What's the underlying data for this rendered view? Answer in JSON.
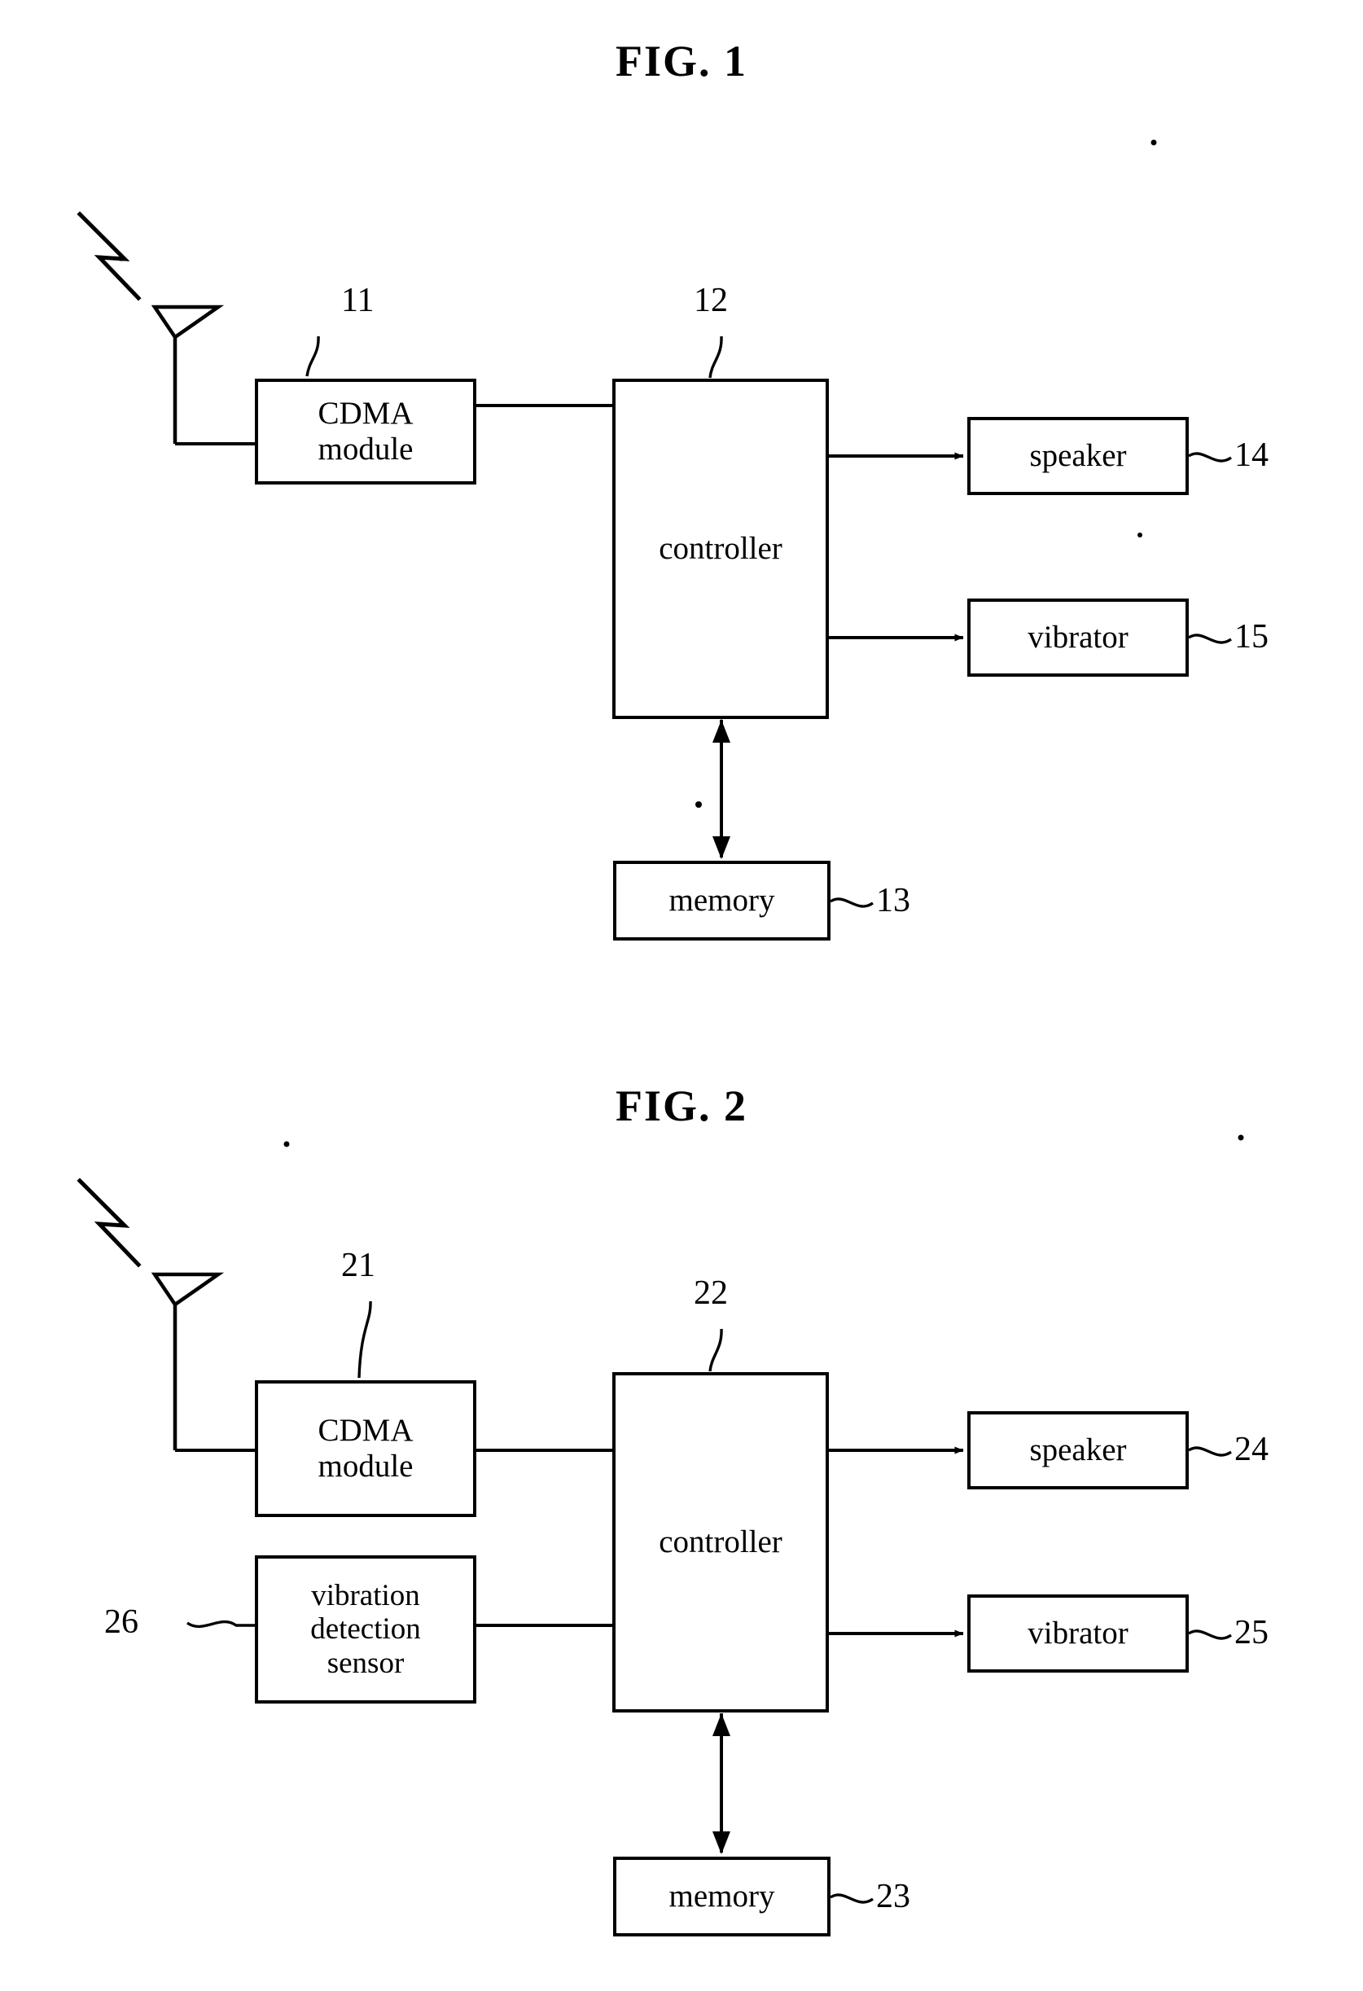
{
  "document": {
    "type": "patent-figure-sheet",
    "background_color": "#ffffff",
    "line_color": "#000000"
  },
  "figures": [
    {
      "title": "FIG. 1",
      "blocks": [
        {
          "id": "cdma-module-11",
          "label_line1": "CDMA",
          "label_line2": "module",
          "ref": "11"
        },
        {
          "id": "controller-12",
          "label_line1": "controller",
          "label_line2": "",
          "ref": "12"
        },
        {
          "id": "speaker-14",
          "label_line1": "speaker",
          "label_line2": "",
          "ref": "14"
        },
        {
          "id": "vibrator-15",
          "label_line1": "vibrator",
          "label_line2": "",
          "ref": "15"
        },
        {
          "id": "memory-13",
          "label_line1": "memory",
          "label_line2": "",
          "ref": "13"
        }
      ],
      "refs": [
        "11",
        "12",
        "13",
        "14",
        "15"
      ]
    },
    {
      "title": "FIG. 2",
      "blocks": [
        {
          "id": "cdma-module-21",
          "label_line1": "CDMA",
          "label_line2": "module",
          "ref": "21"
        },
        {
          "id": "controller-22",
          "label_line1": "controller",
          "label_line2": "",
          "ref": "22"
        },
        {
          "id": "speaker-24",
          "label_line1": "speaker",
          "label_line2": "",
          "ref": "24"
        },
        {
          "id": "vibrator-25",
          "label_line1": "vibrator",
          "label_line2": "",
          "ref": "25"
        },
        {
          "id": "memory-23",
          "label_line1": "memory",
          "label_line2": "",
          "ref": "23"
        },
        {
          "id": "vibration-detection-sensor-26",
          "label_line1": "vibration",
          "label_line2": "detection",
          "label_line3": "sensor",
          "ref": "26"
        }
      ],
      "refs": [
        "21",
        "22",
        "23",
        "24",
        "25",
        "26"
      ]
    }
  ],
  "fig1": {
    "title": "FIG. 1",
    "cdma": {
      "line1": "CDMA",
      "line2": "module"
    },
    "controller": "controller",
    "speaker": "speaker",
    "vibrator": "vibrator",
    "memory": "memory",
    "ref_cdma": "11",
    "ref_controller": "12",
    "ref_memory": "13",
    "ref_speaker": "14",
    "ref_vibrator": "15"
  },
  "fig2": {
    "title": "FIG. 2",
    "cdma": {
      "line1": "CDMA",
      "line2": "module"
    },
    "controller": "controller",
    "speaker": "speaker",
    "vibrator": "vibrator",
    "memory": "memory",
    "sensor": {
      "line1": "vibration",
      "line2": "detection",
      "line3": "sensor"
    },
    "ref_cdma": "21",
    "ref_controller": "22",
    "ref_memory": "23",
    "ref_speaker": "24",
    "ref_vibrator": "25",
    "ref_sensor": "26"
  }
}
